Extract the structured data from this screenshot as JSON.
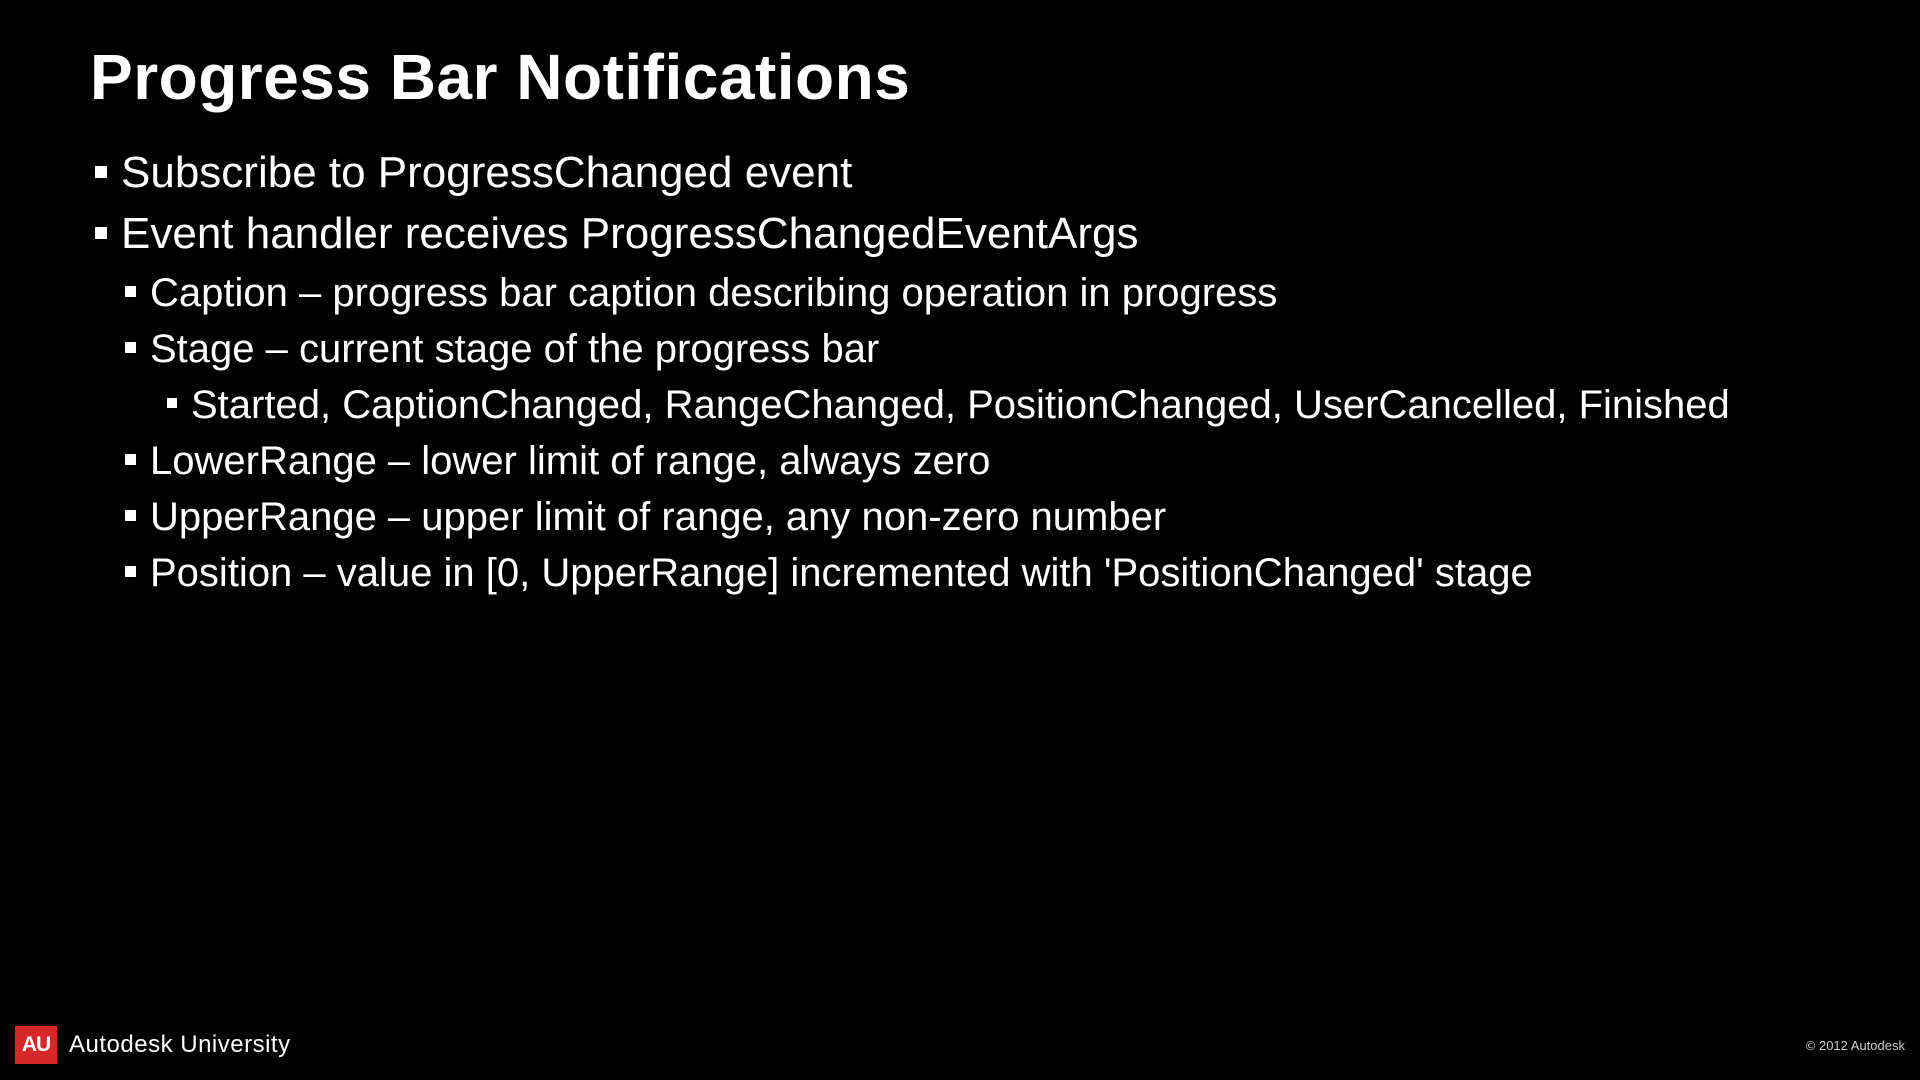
{
  "title": "Progress Bar Notifications",
  "bullets": {
    "b1": "Subscribe to ProgressChanged event",
    "b2": "Event handler receives ProgressChangedEventArgs",
    "b2_1": "Caption – progress bar caption describing operation in progress",
    "b2_2": "Stage – current stage of the progress bar",
    "b2_2_1": "Started, CaptionChanged, RangeChanged, PositionChanged, UserCancelled, Finished",
    "b2_3": "LowerRange – lower limit of range, always zero",
    "b2_4": "UpperRange – upper limit of range, any non-zero number",
    "b2_5": "Position – value in [0, UpperRange] incremented with 'PositionChanged' stage"
  },
  "footer": {
    "badge": "AU",
    "brand": "Autodesk University",
    "copyright": "© 2012 Autodesk"
  }
}
